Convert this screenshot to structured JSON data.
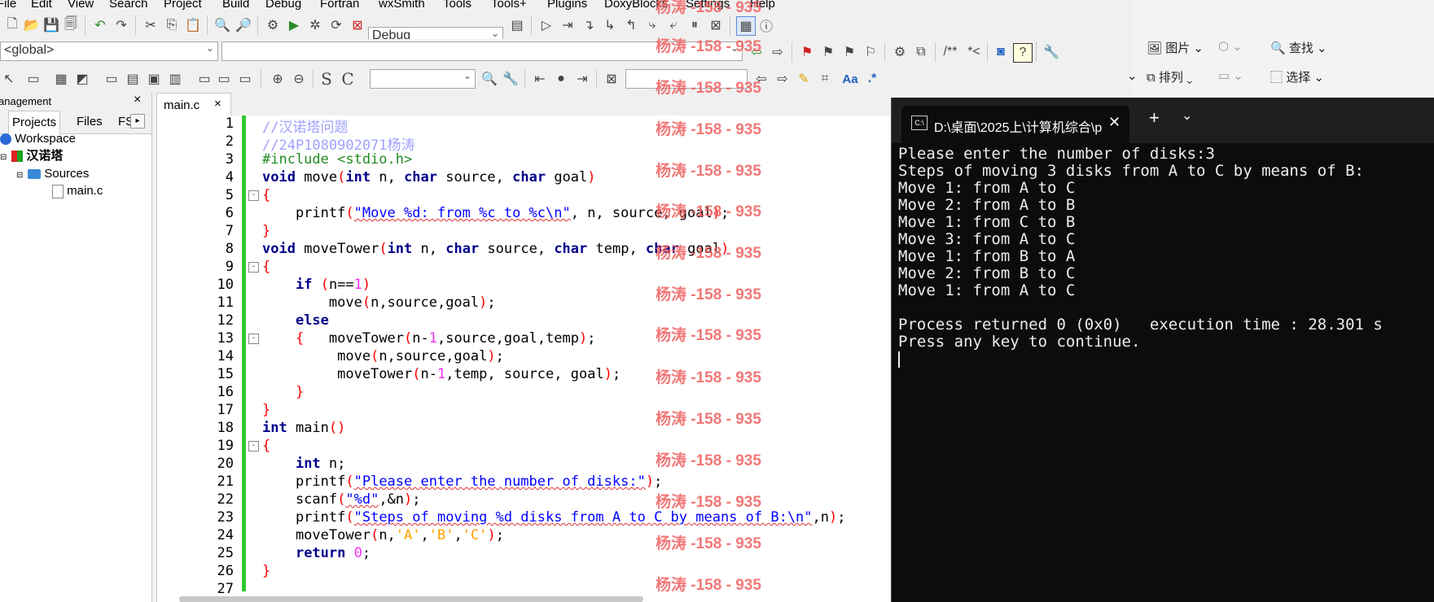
{
  "menu": [
    "File",
    "Edit",
    "View",
    "Search",
    "Project",
    "Build",
    "Debug",
    "Fortran",
    "wxSmith",
    "Tools",
    "Tools+",
    "Plugins",
    "DoxyBlocks",
    "Settings",
    "Help"
  ],
  "toolbar": {
    "build_target": "Debug",
    "scope": "<global>",
    "s_label": "S",
    "c_label": "C",
    "doxy_comment": "/**",
    "doxy_inline": "*<",
    "regex_label": "Aa",
    "regex_dot": ".*"
  },
  "left_panel": {
    "title": "anagement",
    "tabs": [
      "Projects",
      "Files",
      "FS"
    ],
    "workspace": "Workspace",
    "project": "汉诺塔",
    "sources": "Sources",
    "file": "main.c"
  },
  "editor": {
    "tab_label": "main.c",
    "line_numbers": [
      "1",
      "2",
      "3",
      "4",
      "5",
      "6",
      "7",
      "8",
      "9",
      "10",
      "11",
      "12",
      "13",
      "14",
      "15",
      "16",
      "17",
      "18",
      "19",
      "20",
      "21",
      "22",
      "23",
      "24",
      "25",
      "26",
      "27"
    ]
  },
  "watermark": "杨涛 -158 - 935",
  "office": {
    "picture": "图片",
    "find": "查找",
    "arrange": "排列",
    "select": "选择"
  },
  "terminal": {
    "tab_title": "D:\\桌面\\2025上\\计算机综合\\p",
    "lines": [
      "Please enter the number of disks:3",
      "Steps of moving 3 disks from A to C by means of B:",
      "Move 1: from A to C",
      "Move 2: from A to B",
      "Move 1: from C to B",
      "Move 3: from A to C",
      "Move 1: from B to A",
      "Move 2: from B to C",
      "Move 1: from A to C",
      "",
      "Process returned 0 (0x0)   execution time : 28.301 s",
      "Press any key to continue."
    ]
  },
  "colors": {
    "keyword": "#00008b",
    "comment": "#a0a0ff",
    "preprocessor": "#228b22",
    "string": "#0000ff",
    "number": "#f030f0",
    "char": "#ffa000",
    "change_bar": "#31c831",
    "watermark": "#f06060",
    "terminal_bg": "#0c0c0c"
  }
}
